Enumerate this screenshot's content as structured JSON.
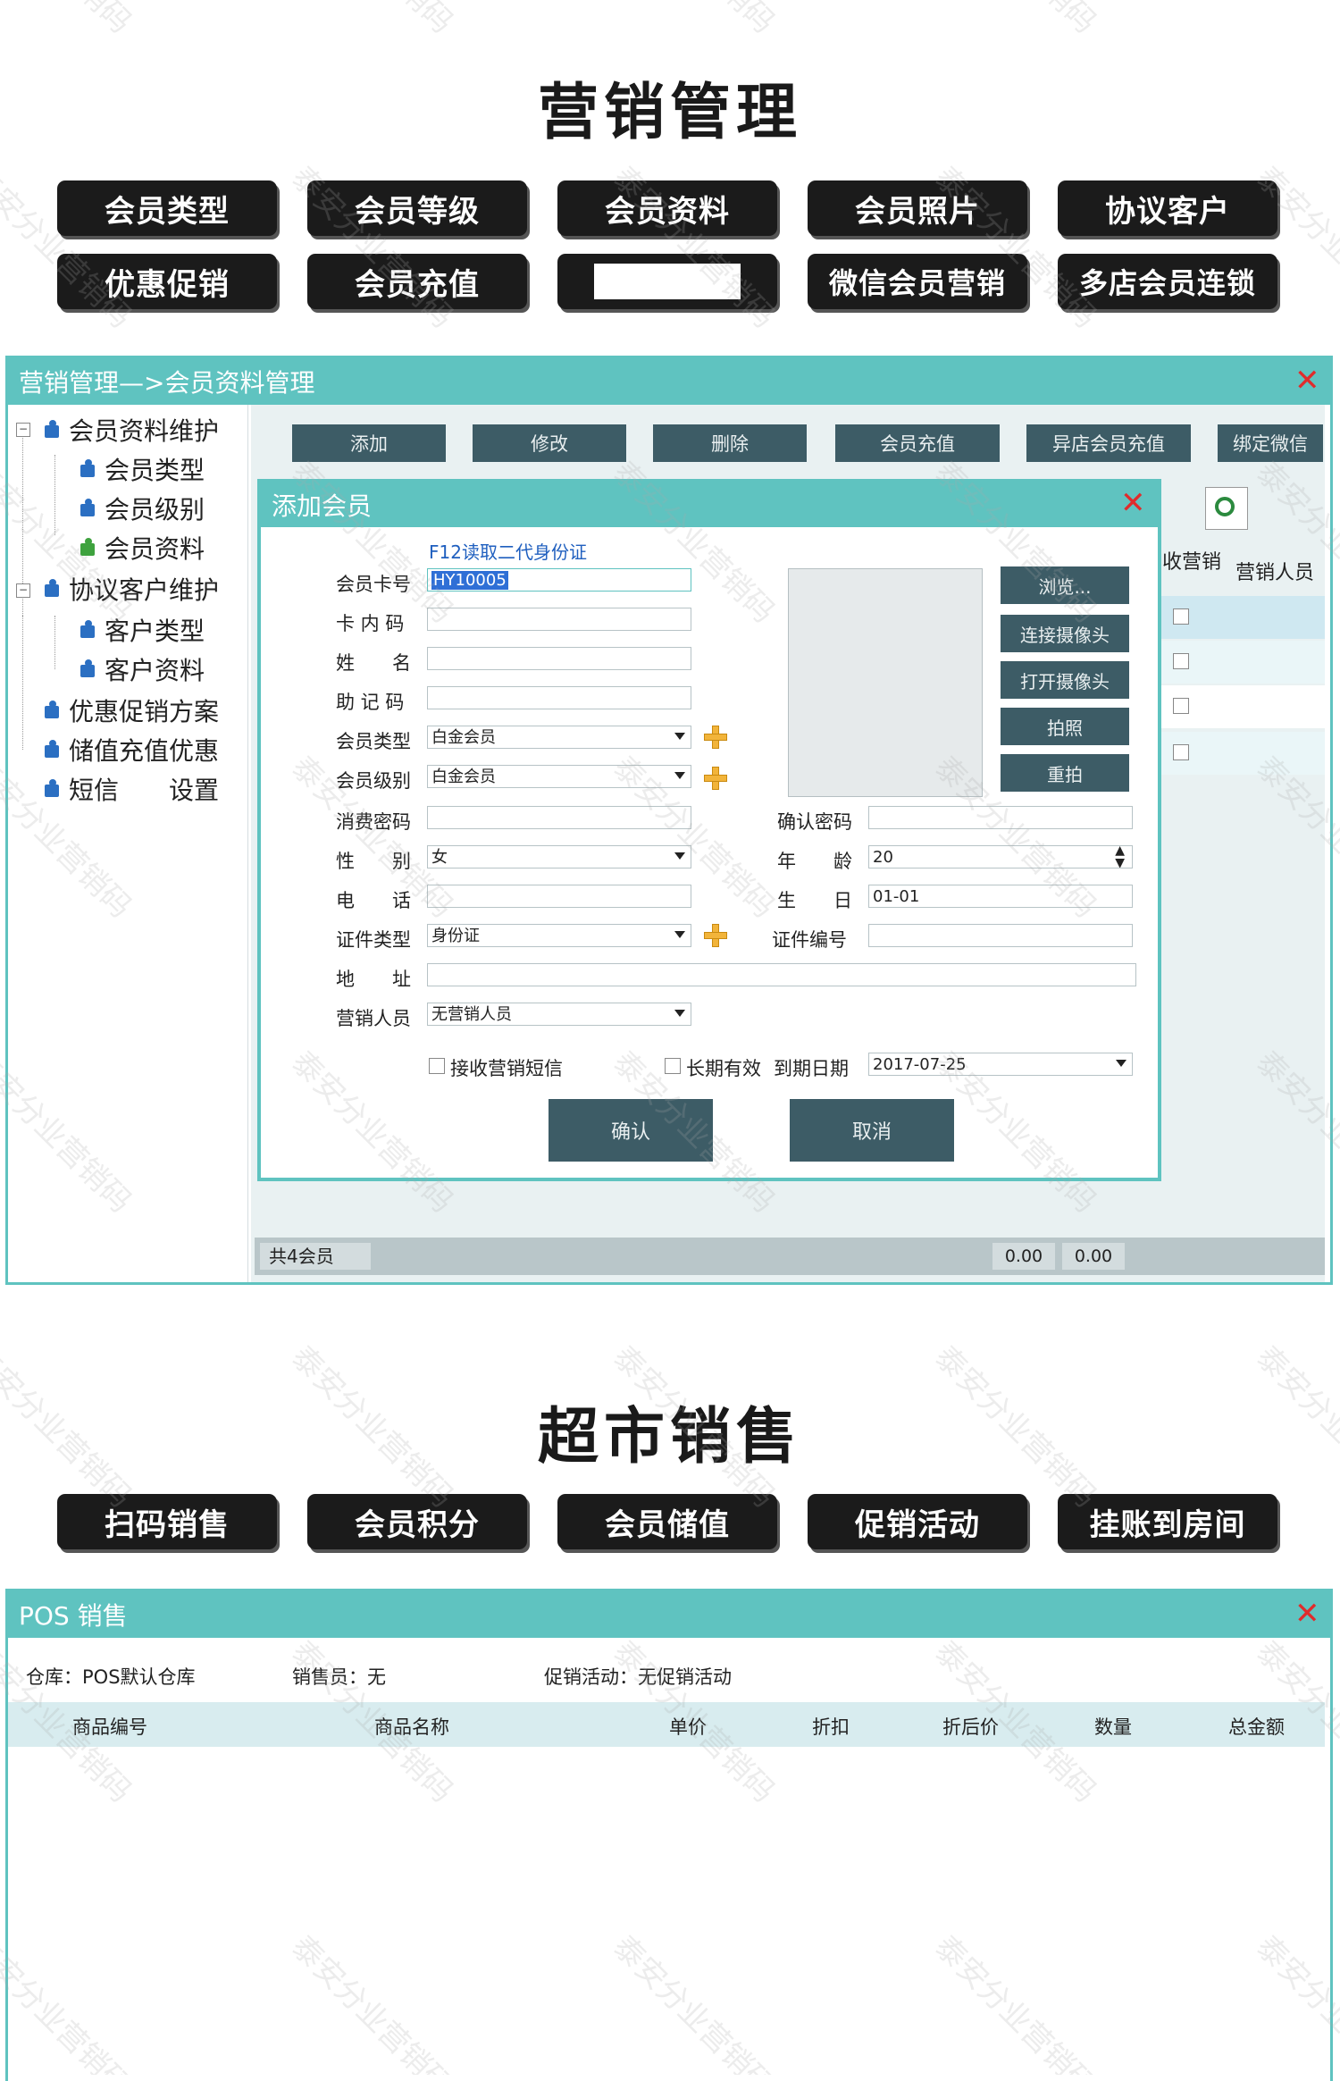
{
  "marketing": {
    "heading": "营销管理",
    "features": [
      "会员类型",
      "会员等级",
      "会员资料",
      "会员照片",
      "协议客户",
      "优惠促销",
      "会员充值",
      "",
      "微信会员营销",
      "多店会员连锁"
    ]
  },
  "member_window": {
    "title": "营销管理—>会员资料管理",
    "tree": [
      "会员资料维护",
      "会员类型",
      "会员级别",
      "会员资料",
      "协议客户维护",
      "客户类型",
      "客户资料",
      "优惠促销方案",
      "储值充值优惠",
      "短信　　设置"
    ],
    "toolbar": [
      "添加",
      "修改",
      "删除",
      "会员充值",
      "异店会员充值",
      "绑定微信"
    ],
    "list_headers": [
      "收营销",
      "营销人员"
    ],
    "status": {
      "count": "共4会员",
      "total1": "0.00",
      "total2": "0.00"
    }
  },
  "add_dialog": {
    "title": "添加会员",
    "hint": "F12读取二代身份证",
    "labels": {
      "card_no": "会员卡号",
      "inner_code": "卡 内 码",
      "name": "姓　　名",
      "mnemonic": "助 记 码",
      "type": "会员类型",
      "level": "会员级别",
      "pay_pwd": "消费密码",
      "confirm_pwd": "确认密码",
      "gender": "性　　别",
      "age": "年　　龄",
      "phone": "电　　话",
      "birthday": "生　　日",
      "id_type": "证件类型",
      "id_no": "证件编号",
      "address": "地　　址",
      "sales": "营销人员"
    },
    "values": {
      "card_no": "HY10005",
      "type": "白金会员",
      "level": "白金会员",
      "gender": "女",
      "age": "20",
      "birthday": "01-01",
      "id_type": "身份证",
      "sales": "无营销人员",
      "expire_date": "2017-07-25"
    },
    "photo_buttons": [
      "浏览...",
      "连接摄像头",
      "打开摄像头",
      "拍照",
      "重拍"
    ],
    "check_sms": "接收营销短信",
    "check_longterm": "长期有效",
    "expire_label": "到期日期",
    "ok": "确认",
    "cancel": "取消"
  },
  "sales": {
    "heading": "超市销售",
    "features": [
      "扫码销售",
      "会员积分",
      "会员储值",
      "促销活动",
      "挂账到房间"
    ]
  },
  "pos_window": {
    "title": "POS 销售",
    "warehouse": "仓库：POS默认仓库",
    "salesperson": "销售员：无",
    "promotion": "促销活动：无促销活动",
    "columns": [
      "商品编号",
      "商品名称",
      "单价",
      "折扣",
      "折后价",
      "数量",
      "总金额"
    ]
  },
  "colors": {
    "accent": "#5fc3c0",
    "button_dark": "#3d5c66",
    "feature_btn": "#1b1b1b",
    "close": "#e02c2c"
  },
  "watermark": "泰安分业营销码"
}
